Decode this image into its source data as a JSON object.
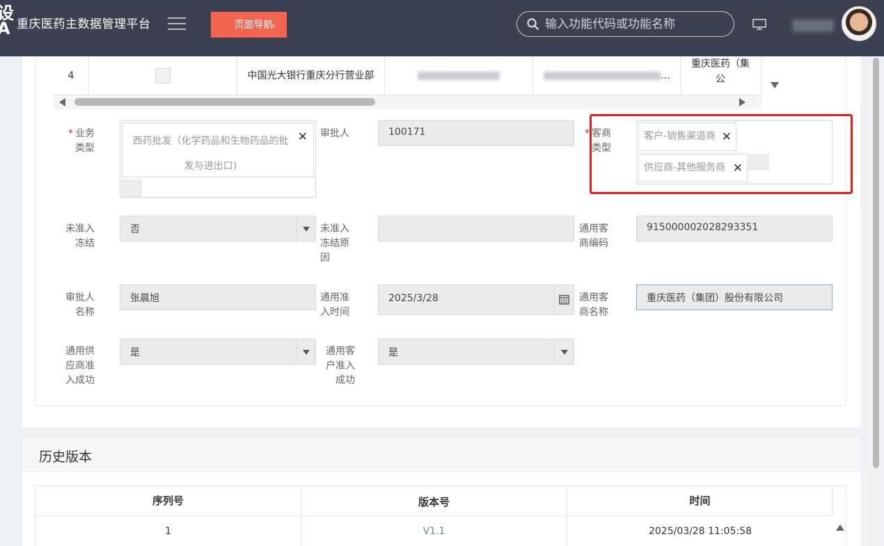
{
  "header": {
    "logo_fragment": "设\nA",
    "app_title": "重庆医药主数据管理平台",
    "nav_button": "页面导航",
    "search_placeholder": "输入功能代码或功能名称"
  },
  "top_table": {
    "row_index": "4",
    "bank": "中国光大银行重庆分行营业部",
    "truncated_dots": "…",
    "company_fragment": "重庆医药（集\n公"
  },
  "form": {
    "business_type": {
      "label": "业务类型",
      "tag": "西药批发（化学药品和生物药品的批发与进出口)"
    },
    "approver": {
      "label": "审批人",
      "value": "100171"
    },
    "merchant_type": {
      "label": "客商类型",
      "tags": [
        "客户-销售渠道商",
        "供应商-其他服务商"
      ]
    },
    "not_admitted_frozen": {
      "label": "未准入冻结",
      "value": "否"
    },
    "freeze_reason": {
      "label": "未准入冻结原因",
      "value": ""
    },
    "merchant_code": {
      "label": "通用客商编码",
      "value": "91500000202829335​1"
    },
    "approver_name": {
      "label": "审批人名称",
      "value": "张晨旭"
    },
    "admit_time": {
      "label": "通用准入时间",
      "value": "2025/3/28"
    },
    "merchant_name": {
      "label": "通用客商名称",
      "value": "重庆医药（集团）股份有限公司"
    },
    "supplier_admitted": {
      "label": "通用供应商准入成功",
      "value": "是"
    },
    "customer_admitted": {
      "label": "通用客户准入成功",
      "value": "是"
    }
  },
  "history": {
    "title": "历史版本",
    "columns": [
      "序列号",
      "版本号",
      "时间"
    ],
    "rows": [
      {
        "seq": "1",
        "version": "V1.1",
        "time": "2025/03/28 11:05:58"
      }
    ]
  },
  "colors": {
    "header_bg": "#3d4050",
    "nav_button": "#f16551",
    "highlight": "#e02020",
    "required": "#e0242b"
  }
}
